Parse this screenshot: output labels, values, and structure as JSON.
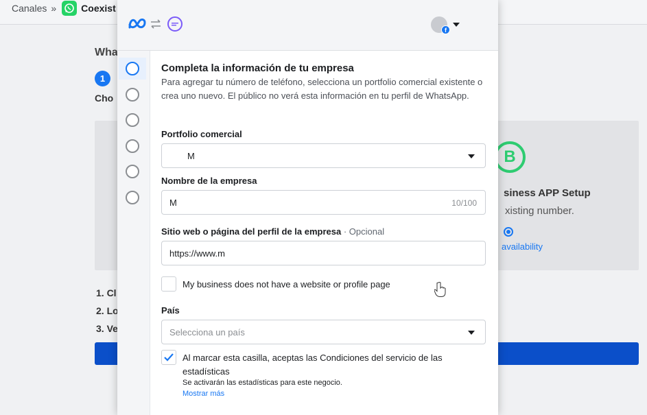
{
  "background": {
    "breadcrumb": {
      "root": "Canales",
      "separator": "»",
      "current": "Coexist"
    },
    "heading": "Wha",
    "step_number": "1",
    "choose_text": "Cho",
    "card": {
      "logo_letter": "B",
      "setup_title": "siness APP Setup",
      "setup_subtitle": "xisting number.",
      "availability": "availability"
    },
    "list": [
      "1. Cl",
      "2. Lo",
      "3. Ve"
    ]
  },
  "modal": {
    "header": {
      "meta_logo": "meta-logo-icon",
      "swap_icon": "swap-icon",
      "partner_logo": "partner-logo-icon",
      "account_icon": "account-avatar-icon"
    },
    "steps_count": 6,
    "title": "Completa la información de tu empresa",
    "description": "Para agregar tu número de teléfono, selecciona un portfolio comercial existente o crea uno nuevo. El público no verá esta información en tu perfil de WhatsApp.",
    "portfolio": {
      "label": "Portfolio comercial",
      "value": "M"
    },
    "company_name": {
      "label": "Nombre de la empresa",
      "value": "M",
      "counter": "10/100"
    },
    "website": {
      "label": "Sitio web o página del perfil de la empresa",
      "optional": "· Opcional",
      "value": "https://www.m"
    },
    "no_website_checkbox": {
      "label": "My business does not have a website or profile page",
      "checked": false
    },
    "country": {
      "label": "País",
      "placeholder": "Selecciona un país"
    },
    "terms_checkbox": {
      "label_prefix": "Al marcar esta casilla, aceptas las ",
      "label_link": "Condiciones del servicio de las estadísticas",
      "checked": true,
      "note": "Se activarán las estadísticas para este negocio.",
      "more": "Mostrar más"
    }
  },
  "colors": {
    "accent": "#1877f2",
    "whatsapp": "#25d366",
    "primary_bar": "#0b4fc9"
  }
}
